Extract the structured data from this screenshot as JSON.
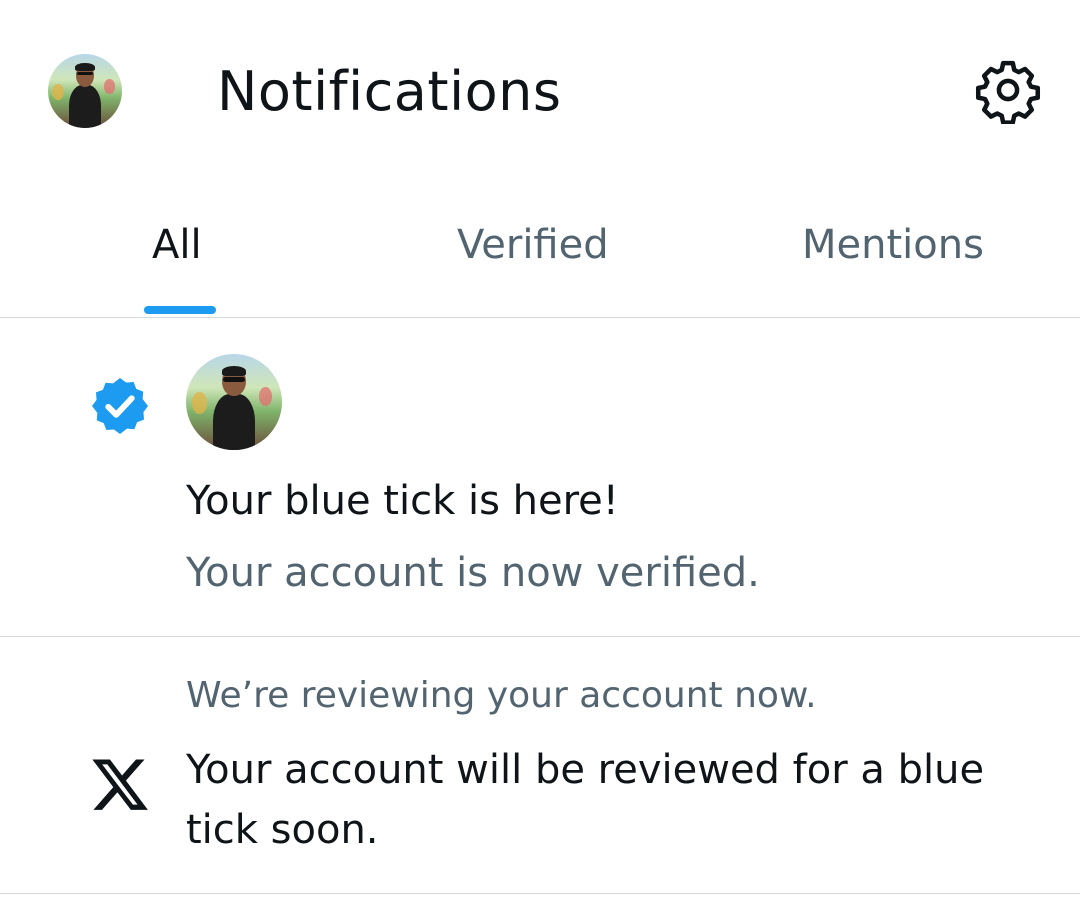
{
  "header": {
    "title": "Notifications",
    "avatar_icon": "user-avatar",
    "settings_icon": "gear-icon"
  },
  "tabs": [
    {
      "label": "All",
      "active": true
    },
    {
      "label": "Verified",
      "active": false
    },
    {
      "label": "Mentions",
      "active": false
    }
  ],
  "notifications": [
    {
      "type_icon": "verified-badge-icon",
      "avatar_icon": "user-avatar",
      "title": "Your blue tick is here!",
      "subtitle": "Your account is now verified."
    },
    {
      "type_icon": "x-logo-icon",
      "header": "We’re reviewing your account now.",
      "body_line1": "Your account will be reviewed for a blue",
      "body_line2": "tick soon."
    }
  ],
  "colors": {
    "accent": "#1d9bf0",
    "text_primary": "#0f1419",
    "text_secondary": "#536471",
    "divider": "#d6dadd"
  }
}
